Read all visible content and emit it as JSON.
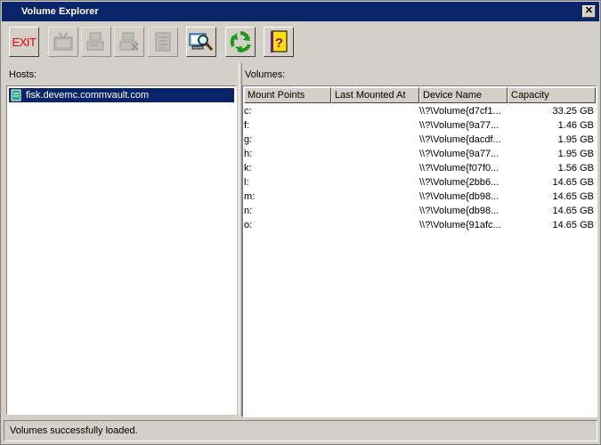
{
  "window": {
    "title": "Volume Explorer",
    "close_glyph": "✕"
  },
  "toolbar": {
    "buttons": [
      {
        "name": "exit-button",
        "label": "EXIT",
        "icon": "exit-text-icon",
        "enabled": true
      },
      {
        "name": "tv-button",
        "icon": "tv-icon",
        "enabled": false
      },
      {
        "name": "host-add-button",
        "icon": "server-icon",
        "enabled": false
      },
      {
        "name": "host-remove-button",
        "icon": "server-x-icon",
        "enabled": false
      },
      {
        "name": "list-button",
        "icon": "list-icon",
        "enabled": false
      },
      {
        "name": "explore-button",
        "icon": "magnifier-icon",
        "enabled": true
      },
      {
        "name": "refresh-button",
        "icon": "refresh-arrows-icon",
        "enabled": true
      },
      {
        "name": "help-button",
        "icon": "help-book-icon",
        "enabled": true
      }
    ]
  },
  "hosts": {
    "label": "Hosts:",
    "items": [
      {
        "name": "fisk.devemc.commvault.com",
        "selected": true
      }
    ]
  },
  "volumes": {
    "label": "Volumes:",
    "columns": [
      "Mount Points",
      "Last Mounted At",
      "Device Name",
      "Capacity"
    ],
    "rows": [
      {
        "mount": "c:",
        "last": "",
        "device": "\\\\?\\Volume{d7cf1...",
        "capacity": "33.25 GB"
      },
      {
        "mount": "f:",
        "last": "",
        "device": "\\\\?\\Volume{9a77...",
        "capacity": "1.46 GB"
      },
      {
        "mount": "g:",
        "last": "",
        "device": "\\\\?\\Volume{dacdf...",
        "capacity": "1.95 GB"
      },
      {
        "mount": "h:",
        "last": "",
        "device": "\\\\?\\Volume{9a77...",
        "capacity": "1.95 GB"
      },
      {
        "mount": "k:",
        "last": "",
        "device": "\\\\?\\Volume{f07f0...",
        "capacity": "1.56 GB"
      },
      {
        "mount": "l:",
        "last": "",
        "device": "\\\\?\\Volume{2bb6...",
        "capacity": "14.65 GB"
      },
      {
        "mount": "m:",
        "last": "",
        "device": "\\\\?\\Volume{db98...",
        "capacity": "14.65 GB"
      },
      {
        "mount": "n:",
        "last": "",
        "device": "\\\\?\\Volume{db98...",
        "capacity": "14.65 GB"
      },
      {
        "mount": "o:",
        "last": "",
        "device": "\\\\?\\Volume{91afc...",
        "capacity": "14.65 GB"
      }
    ]
  },
  "status": {
    "text": "Volumes successfully loaded."
  }
}
